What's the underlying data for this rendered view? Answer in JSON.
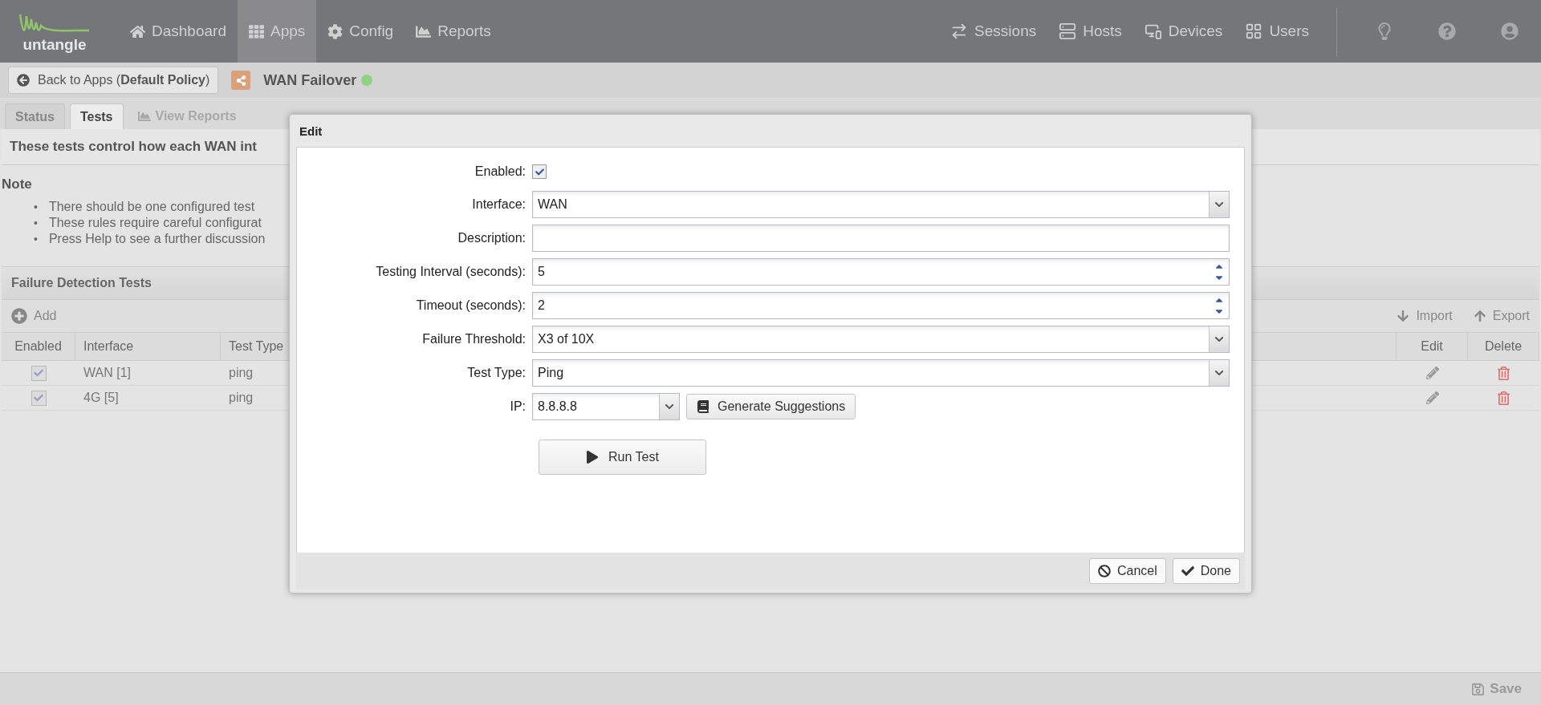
{
  "topbar": {
    "logo": "untangle",
    "nav": [
      {
        "label": "Dashboard",
        "selected": false
      },
      {
        "label": "Apps",
        "selected": true
      },
      {
        "label": "Config",
        "selected": false
      },
      {
        "label": "Reports",
        "selected": false
      }
    ],
    "right_nav": [
      "Sessions",
      "Hosts",
      "Devices",
      "Users"
    ]
  },
  "app_bar": {
    "back_button": "Back to Apps (**Default Policy**)",
    "title": "WAN Failover",
    "running": true
  },
  "tabs": [
    {
      "label": "Status",
      "selected": false,
      "disabled": false
    },
    {
      "label": "Tests",
      "selected": true,
      "disabled": false
    },
    {
      "label": "View Reports",
      "selected": false,
      "disabled": true
    }
  ],
  "description": "These tests control how each WAN int",
  "note": {
    "title": "Note",
    "bullets": [
      {
        "marker": "•",
        "text": "There should be one configured test"
      },
      {
        "marker": "•",
        "text": "These rules require careful configurat"
      },
      {
        "marker": "•",
        "text": "Press Help to see a further discussion"
      }
    ]
  },
  "section": {
    "title": "Failure Detection Tests",
    "add": "Add",
    "import": "Import",
    "export": "Export",
    "columns": [
      "Enabled",
      "Interface",
      "Test Type",
      "Edit",
      "Delete"
    ],
    "rows": [
      {
        "enabled": true,
        "interface": "WAN [1]",
        "test_type": "ping"
      },
      {
        "enabled": true,
        "interface": "4G [5]",
        "test_type": "ping"
      }
    ]
  },
  "footer": {
    "save": "Save"
  },
  "dialog": {
    "title": "Edit",
    "fields": [
      {
        "kind": "checkbox",
        "label": "Enabled:",
        "checked": true
      },
      {
        "kind": "select",
        "label": "Interface:",
        "value": "WAN"
      },
      {
        "kind": "text",
        "label": "Description:"
      },
      {
        "kind": "spinner",
        "label": "Testing Interval (seconds):",
        "value": "5"
      },
      {
        "kind": "spinner",
        "label": "Timeout (seconds):",
        "value": "2"
      },
      {
        "kind": "select",
        "label": "Failure Threshold:",
        "value": "X3 of 10X"
      },
      {
        "kind": "select",
        "label": "Test Type:",
        "value": "Ping"
      },
      {
        "kind": "combo",
        "label": "IP:",
        "value": "8.8.8.8",
        "button": "Generate Suggestions"
      }
    ],
    "run_button": "Run Test",
    "buttons": [
      {
        "kind": "cancel",
        "label": "Cancel"
      },
      {
        "kind": "done",
        "label": "Done"
      }
    ]
  }
}
